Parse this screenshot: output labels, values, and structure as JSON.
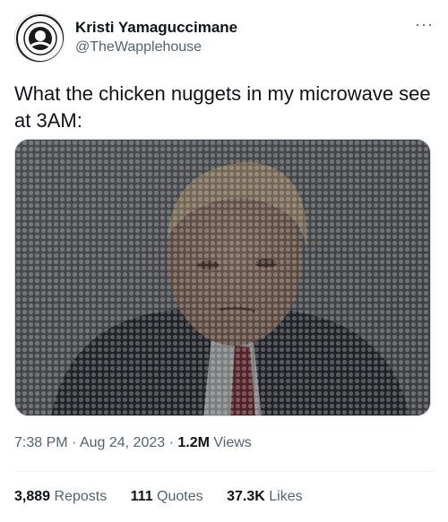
{
  "tweet": {
    "author": {
      "display_name": "Kristi Yamaguccimane",
      "handle": "@TheWapplehouse",
      "avatar_icon": "avatar-badge-icon"
    },
    "more_label": "···",
    "text": "What the chicken nuggets in my microwave see at 3AM:",
    "media": {
      "kind": "photo",
      "icon": "photo-with-microwave-mesh"
    },
    "meta": {
      "time": "7:38 PM",
      "sep1": "·",
      "date": "Aug 24, 2023",
      "sep2": "·",
      "views_count": "1.2M",
      "views_label": "Views"
    },
    "stats": {
      "reposts_count": "3,889",
      "reposts_label": "Reposts",
      "quotes_count": "111",
      "quotes_label": "Quotes",
      "likes_count": "37.3K",
      "likes_label": "Likes"
    }
  },
  "colors": {
    "text_primary": "#0f1419",
    "text_secondary": "#536471",
    "border": "#cfd9de",
    "divider": "#eff3f4"
  }
}
